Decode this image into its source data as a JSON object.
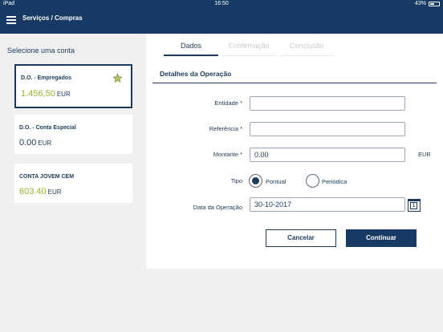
{
  "status_bar": {
    "device": "iPad",
    "time": "16:50",
    "battery": "43%"
  },
  "header": {
    "title": "Serviços / Compras"
  },
  "sidebar": {
    "label": "Selecione uma conta",
    "accounts": [
      {
        "name": "D.O. - Empregados",
        "amount": "1.456,50",
        "currency": "EUR",
        "selected": true,
        "favorite": true
      },
      {
        "name": "D.O. - Conta Especial",
        "amount": "0.00",
        "currency": "EUR",
        "selected": false,
        "favorite": false
      },
      {
        "name": "CONTA JOVEM CEM",
        "amount": "603.40",
        "currency": "EUR",
        "selected": false,
        "favorite": false
      }
    ]
  },
  "tabs": [
    {
      "label": "Dados",
      "active": true
    },
    {
      "label": "Confirmação",
      "active": false
    },
    {
      "label": "Conclusão",
      "active": false
    }
  ],
  "form": {
    "title": "Detalhes da Operação",
    "entidade_label": "Entidade *",
    "entidade_value": "",
    "referencia_label": "Referência *",
    "referencia_value": "",
    "montante_label": "Montante *",
    "montante_value": "0.00",
    "montante_unit": "EUR",
    "tipo_label": "Tipo",
    "tipo_options": [
      {
        "label": "Pontual",
        "checked": true
      },
      {
        "label": "Periódica",
        "checked": false
      }
    ],
    "data_label": "Data da Operação",
    "data_value": "30-10-2017",
    "calendar_day": "1"
  },
  "buttons": {
    "cancel": "Cancelar",
    "continue": "Continuar"
  },
  "colors": {
    "navy": "#163a63",
    "accent_green": "#9ab02f",
    "background": "#f0f0f0"
  }
}
